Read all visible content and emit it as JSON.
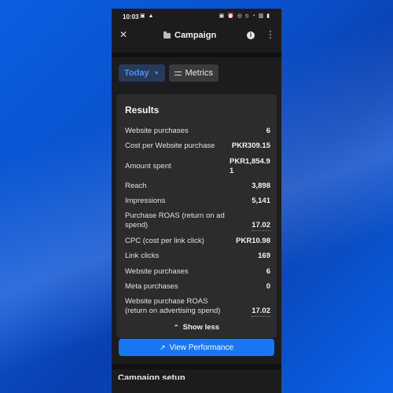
{
  "status_bar": {
    "time": "10:03",
    "left_icons": "▣ ▲",
    "right_icons": "▣ ⏰ ◎ ⦸ ◔ ▥ ▮"
  },
  "app_bar": {
    "close_glyph": "✕",
    "title": "Campaign",
    "info_glyph": "i",
    "more_glyph": "⋮"
  },
  "filters": {
    "period": "Today",
    "period_caret": "▼",
    "metrics": "Metrics"
  },
  "results": {
    "heading": "Results",
    "rows": [
      {
        "label": "Website purchases",
        "value": "6"
      },
      {
        "label": "Cost per Website purchase",
        "value": "PKR309.15"
      },
      {
        "label": "Amount spent",
        "value": "PKR1,854.91"
      },
      {
        "label": "Reach",
        "value": "3,898"
      },
      {
        "label": "Impressions",
        "value": "5,141"
      },
      {
        "label": "Purchase ROAS (return on ad spend)",
        "value": "17.02"
      },
      {
        "label": "CPC (cost per link click)",
        "value": "PKR10.98"
      },
      {
        "label": "Link clicks",
        "value": "169"
      },
      {
        "label": "Website purchases",
        "value": "6"
      },
      {
        "label": "Meta purchases",
        "value": "0"
      },
      {
        "label": "Website purchase ROAS (return on advertising spend)",
        "value": "17.02"
      }
    ],
    "show_less": "Show less",
    "show_less_glyph": "⌃"
  },
  "actions": {
    "view_performance": "View Performance",
    "view_glyph": "↗"
  },
  "next_section": {
    "title": "Campaign setup"
  },
  "colors": {
    "accent": "#1877f2",
    "today_text": "#4f8fff",
    "card_bg": "#2c2c2e",
    "screen_bg": "#1c1c1e"
  }
}
